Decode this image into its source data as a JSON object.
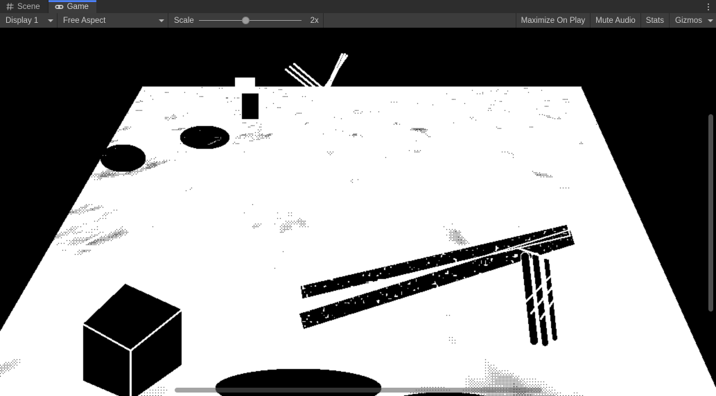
{
  "window": {
    "title": "Game",
    "kebab_icon": "more-options-icon"
  },
  "tabs": [
    {
      "label": "Scene",
      "icon": "scene-grid-icon",
      "active": false
    },
    {
      "label": "Game",
      "icon": "gamepad-icon",
      "active": true
    }
  ],
  "toolbar": {
    "display_dropdown": {
      "label": "Display 1",
      "icon": "chevron-down-icon"
    },
    "aspect_dropdown": {
      "label": "Free Aspect",
      "icon": "chevron-down-icon"
    },
    "scale": {
      "label": "Scale",
      "value": "2x",
      "slider_percent": 42,
      "min": "1x",
      "max": "5x"
    },
    "maximize_on_play": "Maximize On Play",
    "mute_audio": "Mute Audio",
    "stats": "Stats",
    "gizmos": {
      "label": "Gizmos",
      "icon": "chevron-down-icon"
    }
  },
  "game_view": {
    "background_color": "#000000",
    "foreground_color": "#ffffff",
    "render_style": "1-bit threshold / dithered high contrast",
    "vertical_scrollbar": {
      "visible": true
    },
    "horizontal_scrollbar": {
      "visible": true
    }
  },
  "colors": {
    "accent": "#4c7eff",
    "tab_active_bg": "#3c3c3c",
    "tab_inactive_bg": "#2d2d2d",
    "toolbar_bg": "#3c3c3c",
    "window_bg": "#393939",
    "text": "#c8c8c8"
  }
}
